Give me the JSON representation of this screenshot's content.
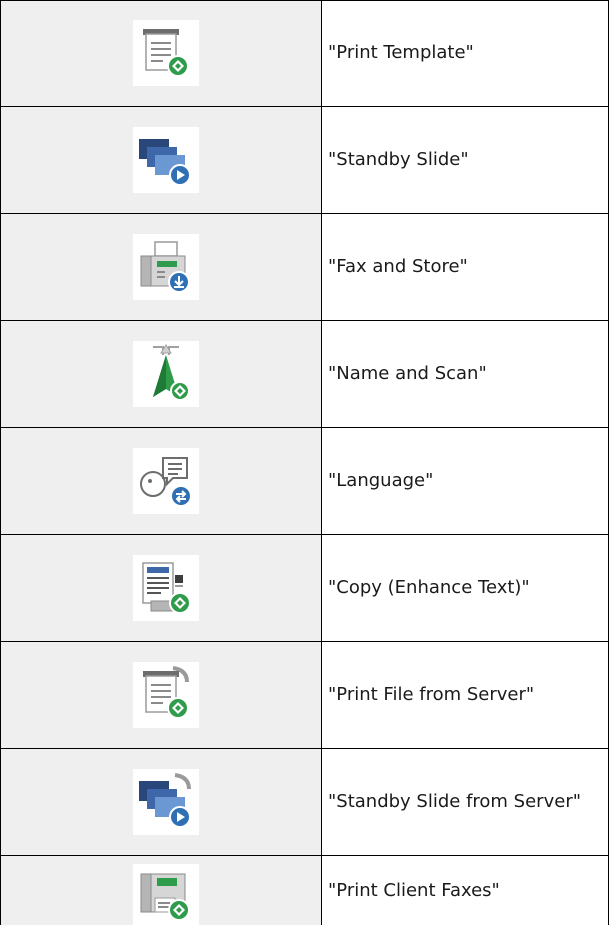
{
  "rows": [
    {
      "icon": "print-template-icon",
      "label": "\"Print Template\""
    },
    {
      "icon": "standby-slide-icon",
      "label": "\"Standby Slide\""
    },
    {
      "icon": "fax-and-store-icon",
      "label": "\"Fax and Store\""
    },
    {
      "icon": "name-and-scan-icon",
      "label": "\"Name and Scan\""
    },
    {
      "icon": "language-icon",
      "label": "\"Language\""
    },
    {
      "icon": "copy-enhance-text-icon",
      "label": "\"Copy (Enhance Text)\""
    },
    {
      "icon": "print-file-from-server-icon",
      "label": "\"Print File from Server\""
    },
    {
      "icon": "standby-slide-from-server-icon",
      "label": "\"Standby Slide from Server\""
    },
    {
      "icon": "print-client-faxes-icon",
      "label": "\"Print Client Faxes\""
    }
  ],
  "colors": {
    "icon_cell_bg": "#efefef",
    "green": "#2e9c4a",
    "blue": "#2f6fb3",
    "gray": "#8a8a8a"
  }
}
